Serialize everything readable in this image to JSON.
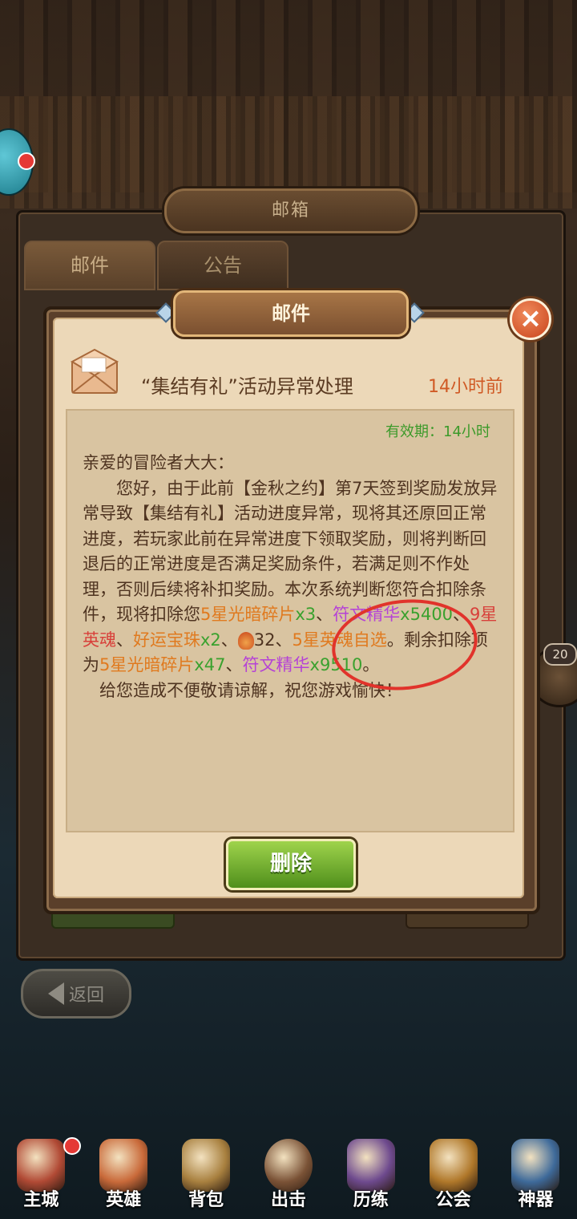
{
  "mailbox": {
    "title": "邮箱",
    "tabs": [
      "邮件",
      "公告"
    ],
    "back_label": "返回",
    "side_badge": "20"
  },
  "mail": {
    "dialog_title": "邮件",
    "subject": "“集结有礼”活动异常处理",
    "time_ago": "14小时前",
    "validity": "有效期：14小时",
    "greeting": "亲爱的冒险者大大：",
    "p1": "您好，由于此前【金秋之约】第7天签到奖励发放异常导致【集结有礼】活动进度异常，现将其还原回正常进度，若玩家此前在异常进度下领取奖励，则将判断回退后的正常进度是否满足奖励条件，若满足则不作处理，否则后续将补扣奖励。本次系统判断您符合扣除条件，现将扣除您",
    "i1": "5星光暗碎片",
    "i1q": "x3",
    "sep": "、",
    "i2": "符文精华",
    "i2q": "x5400",
    "i3": "9星英魂",
    "i4": "好运宝珠",
    "i4q": "x2",
    "i5q": "32",
    "i6": "5星英魂自选",
    "mid": "。剩余扣除项为",
    "i7": "5星光暗碎片",
    "i7q": "x47",
    "i8": "符文精华",
    "i8q": "x9510",
    "end": "。",
    "closing": "给您造成不便敬请谅解，祝您游戏愉快！",
    "delete_label": "删除",
    "close_icon": "×"
  },
  "nav": [
    {
      "label": "主城",
      "color": "#b14a35"
    },
    {
      "label": "英雄",
      "color": "#c96a3a"
    },
    {
      "label": "背包",
      "color": "#a8803f"
    },
    {
      "label": "出击",
      "color": "#7a5236"
    },
    {
      "label": "历练",
      "color": "#6e4a8e"
    },
    {
      "label": "公会",
      "color": "#b0782a"
    },
    {
      "label": "神器",
      "color": "#3e6a9a"
    }
  ]
}
